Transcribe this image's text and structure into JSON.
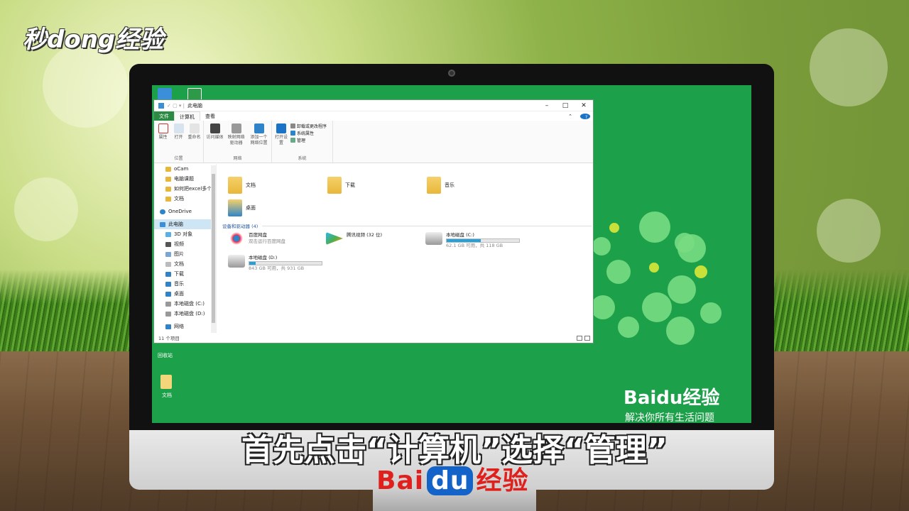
{
  "corner_logo": "秒dong经验",
  "subtitle": "首先点击“计算机”选择“管理”",
  "chin_logo": {
    "bai": "Bai",
    "du": "du",
    "jingyan": "经验"
  },
  "screen_brand": {
    "logo": "Baidu经验",
    "slogan": "解决你所有生活问题"
  },
  "desktop_icons": {
    "recycle": "回收站",
    "docs": "文档"
  },
  "window": {
    "title": "此电脑",
    "tabs": [
      "文件",
      "计算机",
      "查看"
    ],
    "ribbon": {
      "location": {
        "name": "位置",
        "buttons": [
          "属性",
          "打开",
          "重命名"
        ]
      },
      "network": {
        "name": "网络",
        "buttons": [
          "访问媒体",
          "映射网络驱动器",
          "添加一个网络位置"
        ]
      },
      "system": {
        "name": "系统",
        "buttons": [
          "打开设置"
        ],
        "links": [
          "卸载或更改程序",
          "系统属性",
          "管理"
        ]
      }
    },
    "nav": [
      "oCam",
      "电脑课题",
      "如何把excel多个",
      "文档",
      "OneDrive",
      "此电脑",
      "3D 对象",
      "视频",
      "图片",
      "文档",
      "下载",
      "音乐",
      "桌面",
      "本地磁盘 (C:)",
      "本地磁盘 (D:)",
      "网络"
    ],
    "folders": [
      "文档",
      "下载",
      "音乐",
      "桌面"
    ],
    "devices_header": "设备和驱动器 (4)",
    "devices": [
      {
        "name": "百度网盘",
        "sub": "双击运行百度网盘"
      },
      {
        "name": "腾讯视频 (32 位)",
        "sub": ""
      },
      {
        "name": "本地磁盘 (C:)",
        "sub": "62.1 GB 可用，共 118 GB",
        "usage": 0.47
      },
      {
        "name": "本地磁盘 (D:)",
        "sub": "843 GB 可用，共 931 GB",
        "usage": 0.09
      }
    ],
    "status": "11 个项目"
  }
}
